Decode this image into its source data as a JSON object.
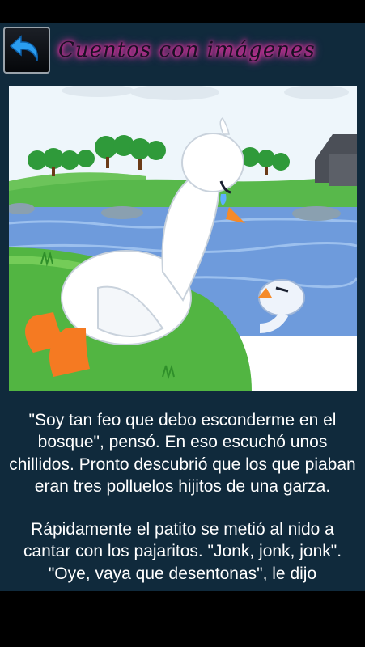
{
  "app": {
    "title": "Cuentos con imágenes"
  },
  "header": {
    "back_icon": "back-arrow-icon"
  },
  "illustration": {
    "subject": "duckling-on-grass-by-pond-illustration"
  },
  "story": {
    "paragraph_1": "\"Soy tan feo que debo esconderme en el bosque\", pensó. En eso escuchó unos chillidos. Pronto descubrió que los que piaban eran tres polluelos hijitos de una garza.",
    "paragraph_2": "Rápidamente el patito se metió al nido a cantar con los pajaritos. \"Jonk, jonk, jonk\". \"Oye, vaya que desentonas\", le dijo"
  },
  "colors": {
    "background": "#102a3c",
    "title_glow": "#ff2fae",
    "back_arrow": "#2a9df0"
  }
}
